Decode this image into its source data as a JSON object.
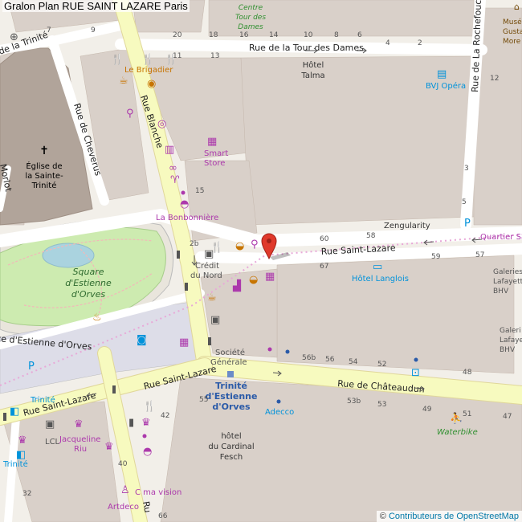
{
  "title": "Gralon Plan RUE SAINT LAZARE Paris",
  "attribution": {
    "prefix": "© ",
    "link": "Contributeurs de OpenStreetMap"
  },
  "colors": {
    "water": "#aad3df",
    "park": "#cdebb0",
    "building": "#d9d0c9",
    "road_yellow": "#f7fabf",
    "road_white": "#ffffff",
    "poi_orange": "#c77400",
    "poi_purple": "#ac39ac",
    "poi_blue": "#0092da",
    "marker": "#e0392b",
    "label": "#333333"
  },
  "streets": {
    "tour_des_dames": "Rue de la Tour des Dames",
    "saint_lazare_top": "Rue Saint-Lazare",
    "saint_lazare_bottom": "Rue Saint-Lazare",
    "chateaudun": "Rue de Châteaudun",
    "blanche": "Rue Blanche",
    "cheverus": "Rue de Cheverus",
    "trinite": "de la Trinité",
    "rochefoucauld": "Rue de La Rochefoucauld",
    "estienne_orves": "ce d'Estienne d'Orves",
    "morlot": "Morlot",
    "ru": "Ru"
  },
  "places": {
    "church": [
      "Église de",
      "la Sainte-",
      "Trinité"
    ],
    "square": [
      "Square",
      "d'Estienne",
      "d'Orves"
    ],
    "centre": [
      "Centre",
      "Tour des",
      "Dames"
    ],
    "hotel_talma": [
      "Hôtel",
      "Talma"
    ],
    "hotel_cardinal": [
      "hôtel",
      "du Cardinal",
      "Fesch"
    ],
    "trinite_station": [
      "Trinité",
      "d'Estienne",
      "d'Orves"
    ],
    "musee": [
      "Musé",
      "Gusta",
      "More"
    ],
    "galeries1": [
      "Galeries",
      "Lafayette",
      "BHV"
    ],
    "galeries2": [
      "Galeri",
      "Lafaye",
      "BHV"
    ]
  },
  "pois": {
    "le_brigadier": "Le Brigadier",
    "bvj": "BVJ Opéra",
    "smart_store": [
      "Smart",
      "Store"
    ],
    "bonbonniere": "La Bonbonnière",
    "zengularity": "Zengularity",
    "quartier": "Quartier Saint",
    "credit": [
      "Crédit",
      "du Nord"
    ],
    "hotel_langlois": "Hôtel Langlois",
    "societe": [
      "Société",
      "Générale"
    ],
    "adecco": "Adecco",
    "waterbike": "Waterbike",
    "trinite1": "Trinité",
    "trinite2": "Trinité",
    "lcl": "LCL",
    "jacqueline": [
      "Jacqueline",
      "Riu"
    ],
    "cma": "C ma vision",
    "artdeco": "Artdeco"
  },
  "numbers": {
    "n20": "20",
    "n18": "18",
    "n16": "16",
    "n14": "14",
    "n10": "10",
    "n8": "8",
    "n6": "6",
    "n4": "4",
    "n2": "2",
    "n13": "13",
    "n11": "11",
    "n15": "15",
    "n2b": "2b",
    "n60": "60",
    "n58": "58",
    "n67": "67",
    "n59": "59",
    "n57": "57",
    "n56b": "56b",
    "n56": "56",
    "n54": "54",
    "n52": "52",
    "n48": "48",
    "n53b": "53b",
    "n53": "53",
    "n49": "49",
    "n47": "47",
    "n51": "51",
    "n55": "55",
    "n42": "42",
    "n40": "40",
    "n66": "66",
    "n32": "32",
    "n5": "5",
    "n3": "3",
    "n9": "9",
    "n7": "7",
    "n12": "12"
  }
}
